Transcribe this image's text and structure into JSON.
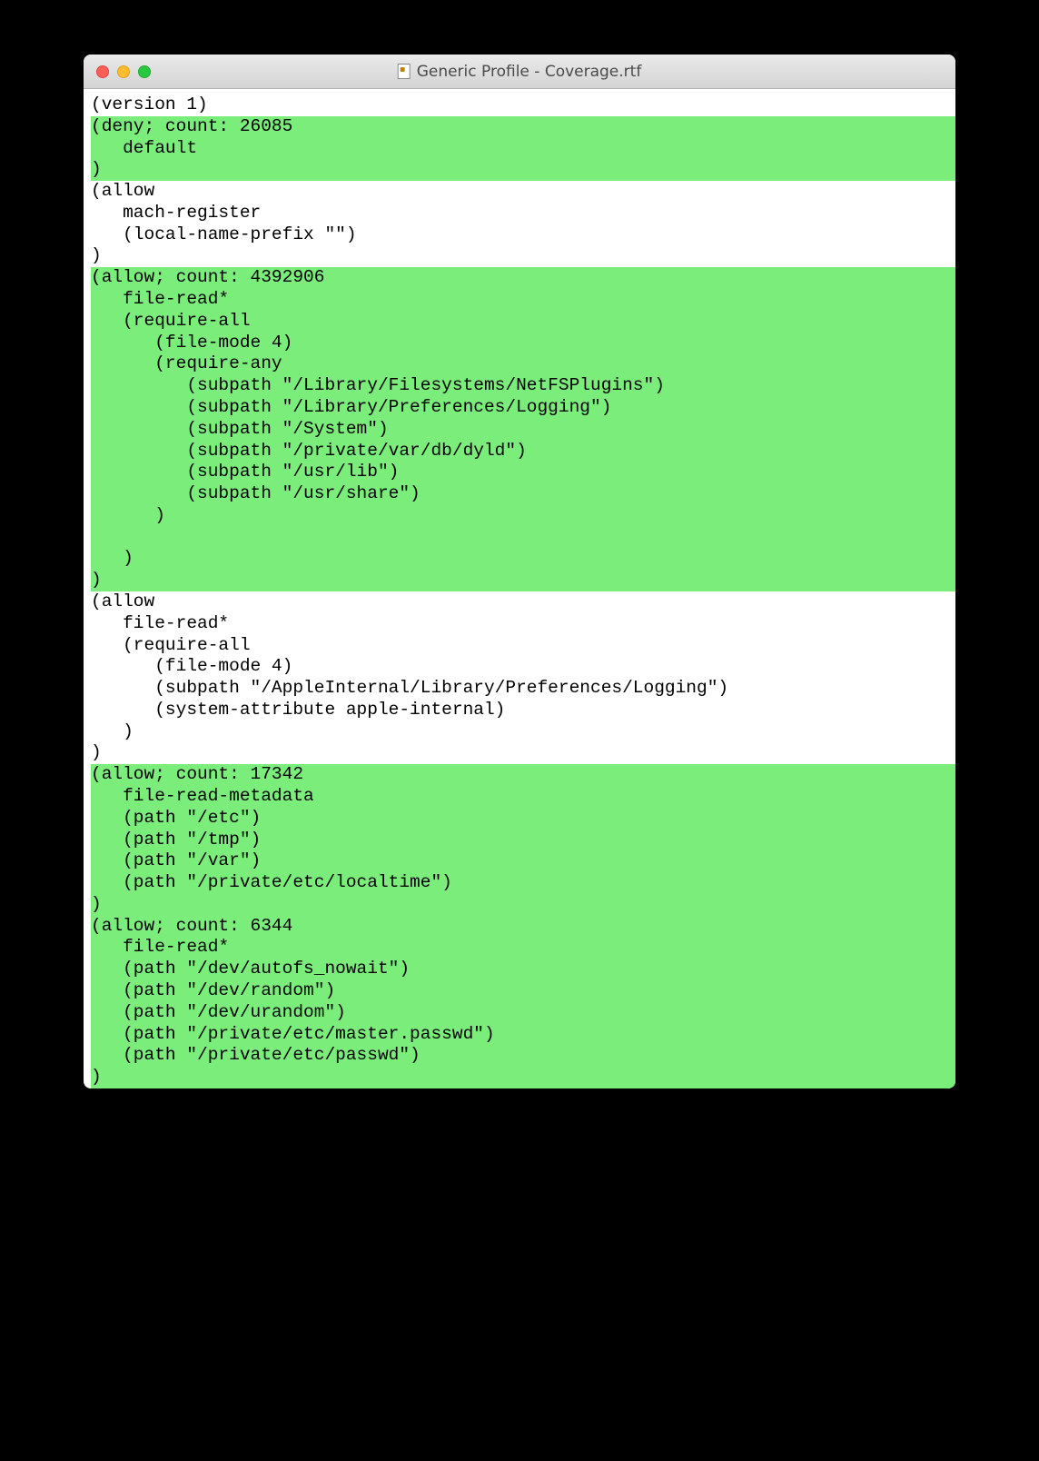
{
  "window": {
    "title": "Generic Profile - Coverage.rtf"
  },
  "colors": {
    "highlight": "#7bed7b"
  },
  "code": {
    "blocks": [
      {
        "hl": false,
        "text": "(version 1)"
      },
      {
        "hl": true,
        "text": "(deny; count: 26085\n   default\n)"
      },
      {
        "hl": false,
        "text": "(allow\n   mach-register\n   (local-name-prefix \"\")\n)"
      },
      {
        "hl": true,
        "text": "(allow; count: 4392906\n   file-read*\n   (require-all\n      (file-mode 4)\n      (require-any\n         (subpath \"/Library/Filesystems/NetFSPlugins\")\n         (subpath \"/Library/Preferences/Logging\")\n         (subpath \"/System\")\n         (subpath \"/private/var/db/dyld\")\n         (subpath \"/usr/lib\")\n         (subpath \"/usr/share\")\n      )\n\n   )\n)"
      },
      {
        "hl": false,
        "text": "(allow\n   file-read*\n   (require-all\n      (file-mode 4)\n      (subpath \"/AppleInternal/Library/Preferences/Logging\")\n      (system-attribute apple-internal)\n   )\n)"
      },
      {
        "hl": true,
        "text": "(allow; count: 17342\n   file-read-metadata\n   (path \"/etc\")\n   (path \"/tmp\")\n   (path \"/var\")\n   (path \"/private/etc/localtime\")\n)"
      },
      {
        "hl": true,
        "text": "(allow; count: 6344\n   file-read*\n   (path \"/dev/autofs_nowait\")\n   (path \"/dev/random\")\n   (path \"/dev/urandom\")\n   (path \"/private/etc/master.passwd\")\n   (path \"/private/etc/passwd\")\n)"
      }
    ]
  }
}
